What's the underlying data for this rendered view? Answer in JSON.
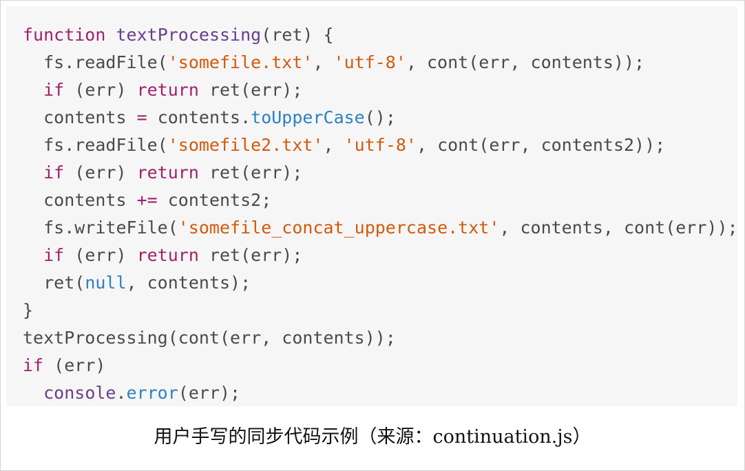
{
  "code": {
    "lines": [
      [
        [
          "kw",
          "function"
        ],
        [
          "plain",
          " "
        ],
        [
          "fn",
          "textProcessing"
        ],
        [
          "plain",
          "(ret) {"
        ]
      ],
      [
        [
          "plain",
          "  fs.readFile("
        ],
        [
          "str",
          "'somefile.txt'"
        ],
        [
          "plain",
          ", "
        ],
        [
          "str",
          "'utf-8'"
        ],
        [
          "plain",
          ", cont(err, contents));"
        ]
      ],
      [
        [
          "plain",
          "  "
        ],
        [
          "kw",
          "if"
        ],
        [
          "plain",
          " (err) "
        ],
        [
          "kw",
          "return"
        ],
        [
          "plain",
          " ret(err);"
        ]
      ],
      [
        [
          "plain",
          "  contents "
        ],
        [
          "op",
          "="
        ],
        [
          "plain",
          " contents."
        ],
        [
          "method",
          "toUpperCase"
        ],
        [
          "plain",
          "();"
        ]
      ],
      [
        [
          "plain",
          "  fs.readFile("
        ],
        [
          "str",
          "'somefile2.txt'"
        ],
        [
          "plain",
          ", "
        ],
        [
          "str",
          "'utf-8'"
        ],
        [
          "plain",
          ", cont(err, contents2));"
        ]
      ],
      [
        [
          "plain",
          "  "
        ],
        [
          "kw",
          "if"
        ],
        [
          "plain",
          " (err) "
        ],
        [
          "kw",
          "return"
        ],
        [
          "plain",
          " ret(err);"
        ]
      ],
      [
        [
          "plain",
          "  contents "
        ],
        [
          "op",
          "+="
        ],
        [
          "plain",
          " contents2;"
        ]
      ],
      [
        [
          "plain",
          "  fs.writeFile("
        ],
        [
          "str",
          "'somefile_concat_uppercase.txt'"
        ],
        [
          "plain",
          ", contents, cont(err));"
        ]
      ],
      [
        [
          "plain",
          "  "
        ],
        [
          "kw",
          "if"
        ],
        [
          "plain",
          " (err) "
        ],
        [
          "kw",
          "return"
        ],
        [
          "plain",
          " ret(err);"
        ]
      ],
      [
        [
          "plain",
          "  ret("
        ],
        [
          "lit",
          "null"
        ],
        [
          "plain",
          ", contents);"
        ]
      ],
      [
        [
          "plain",
          "}"
        ]
      ],
      [
        [
          "plain",
          "textProcessing(cont(err, contents));"
        ]
      ],
      [
        [
          "kw",
          "if"
        ],
        [
          "plain",
          " (err)"
        ]
      ],
      [
        [
          "plain",
          "  "
        ],
        [
          "builtin",
          "console"
        ],
        [
          "plain",
          "."
        ],
        [
          "method",
          "error"
        ],
        [
          "plain",
          "(err);"
        ]
      ]
    ]
  },
  "caption": "用户手写的同步代码示例（来源：continuation.js）",
  "colors": {
    "code_background": "#f6f6f6",
    "keyword": "#a0216c",
    "function_name": "#6a3e8d",
    "string": "#d4590b",
    "method": "#2b82c4",
    "literal": "#2b82c4",
    "plain": "#4a4a4a"
  }
}
